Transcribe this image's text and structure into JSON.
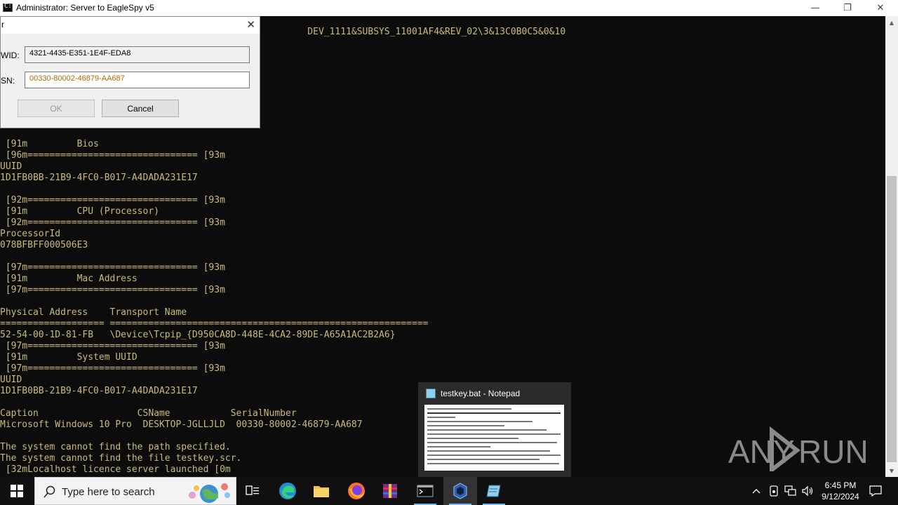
{
  "window": {
    "title": "Administrator:  Server to EagleSpy v5",
    "minimize": "—",
    "maximize": "❐",
    "close": "✕"
  },
  "console_lines": [
    "                                                        DEV_1111&SUBSYS_11001AF4&REV_02\\3&13C0B0C5&0&10",
    "",
    "",
    "",
    "",
    "",
    "",
    "",
    "",
    "",
    " [91m         Bios",
    " [96m=============================== [93m",
    "UUID",
    "1D1FB0BB-21B9-4FC0-B017-A4DADA231E17",
    "",
    " [92m=============================== [93m",
    " [91m         CPU (Processor)",
    " [92m=============================== [93m",
    "ProcessorId",
    "078BFBFF000506E3",
    "",
    " [97m=============================== [93m",
    " [91m         Mac Address",
    " [97m=============================== [93m",
    "",
    "Physical Address    Transport Name",
    "=================== ==========================================================",
    "52-54-00-1D-81-FB   \\Device\\Tcpip_{D950CA8D-448E-4CA2-89DE-A65A1AC2B2A6}",
    " [97m=============================== [93m",
    " [91m         System UUID",
    " [97m=============================== [93m",
    "UUID",
    "1D1FB0BB-21B9-4FC0-B017-A4DADA231E17",
    "",
    "Caption                  CSName           SerialNumber",
    "Microsoft Windows 10 Pro  DESKTOP-JGLLJLD  00330-80002-46879-AA687",
    "",
    "The system cannot find the path specified.",
    "The system cannot find the file testkey.scr.",
    " [32mLocalhost licence server launched [0m"
  ],
  "dialog": {
    "title": "r",
    "close": "✕",
    "hwid_label": "WID:",
    "hwid_value": "4321-4435-E351-1E4F-EDA8",
    "sn_label": "SN:",
    "sn_value": "00330-80002-46879-AA687",
    "ok_label": "OK",
    "cancel_label": "Cancel"
  },
  "preview": {
    "title": "testkey.bat - Notepad"
  },
  "watermark": {
    "text_left": "ANY",
    "text_right": "RUN"
  },
  "taskbar": {
    "search_placeholder": "Type here to search",
    "time": "6:45 PM",
    "date": "9/12/2024"
  },
  "colors": {
    "console_text": "#c8bd76",
    "console_bg": "#0c0c0c",
    "taskbar_bg": "#101010",
    "accent": "#76b9ed"
  }
}
